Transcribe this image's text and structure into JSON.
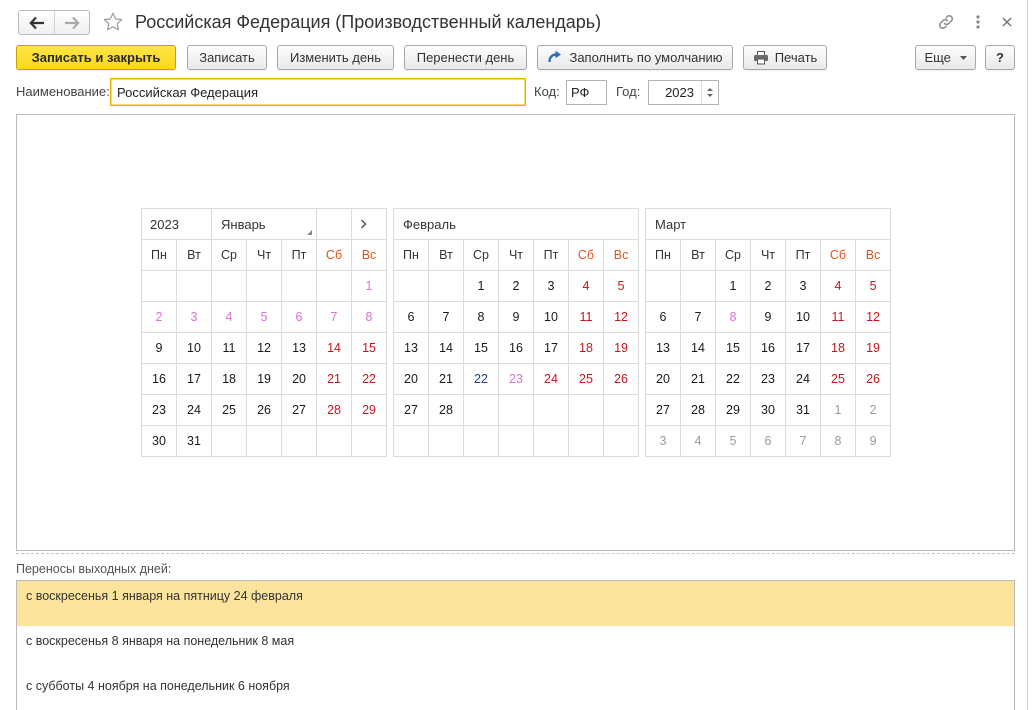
{
  "window": {
    "title": "Российская Федерация (Производственный календарь)"
  },
  "icons": {
    "back": "arrow-left-icon",
    "forward": "arrow-right-icon",
    "favorite": "star-icon",
    "link": "link-icon",
    "more": "more-vertical-icon",
    "close": "close-icon",
    "fill_default": "refresh-arrow-icon",
    "print": "printer-icon",
    "more_dropdown": "caret-down-icon",
    "year_spin": "spinner-icon",
    "month_dropdown": "dropdown-corner-icon",
    "next_month": "chevron-right-icon"
  },
  "colors": {
    "primary_button": "#f9d71c",
    "focus_border": "#e7b300",
    "selected_row": "#fce49c",
    "weekend_header": "#e0541c",
    "work_day": "#1a1a1a"
  },
  "toolbar": {
    "save_close": "Записать и закрыть",
    "save": "Записать",
    "change_day": "Изменить день",
    "move_day": "Перенести день",
    "fill_default": "Заполнить по умолчанию",
    "print": "Печать",
    "more": "Еще",
    "help": "?"
  },
  "form": {
    "name_label": "Наименование:",
    "name_value": "Российская Федерация",
    "code_label": "Код:",
    "code_value": "РФ",
    "year_label": "Год:",
    "year_value": "2023"
  },
  "calendar": {
    "year": "2023",
    "weekdays": [
      "Пн",
      "Вт",
      "Ср",
      "Чт",
      "Пт",
      "Сб",
      "Вс"
    ],
    "months": [
      {
        "name": "Январь",
        "weeks": [
          [
            null,
            null,
            null,
            null,
            null,
            null,
            {
              "d": "1",
              "color": "#dd6fd6"
            }
          ],
          [
            {
              "d": "2",
              "color": "#dd6fd6"
            },
            {
              "d": "3",
              "color": "#dd6fd6"
            },
            {
              "d": "4",
              "color": "#dd6fd6"
            },
            {
              "d": "5",
              "color": "#dd6fd6"
            },
            {
              "d": "6",
              "color": "#dd6fd6"
            },
            {
              "d": "7",
              "color": "#dd6fd6"
            },
            {
              "d": "8",
              "color": "#dd6fd6"
            }
          ],
          [
            {
              "d": "9"
            },
            {
              "d": "10"
            },
            {
              "d": "11"
            },
            {
              "d": "12"
            },
            {
              "d": "13"
            },
            {
              "d": "14",
              "color": "#c4161c"
            },
            {
              "d": "15",
              "color": "#c4161c"
            }
          ],
          [
            {
              "d": "16"
            },
            {
              "d": "17"
            },
            {
              "d": "18"
            },
            {
              "d": "19"
            },
            {
              "d": "20"
            },
            {
              "d": "21",
              "color": "#c4161c"
            },
            {
              "d": "22",
              "color": "#c4161c"
            }
          ],
          [
            {
              "d": "23"
            },
            {
              "d": "24"
            },
            {
              "d": "25"
            },
            {
              "d": "26"
            },
            {
              "d": "27"
            },
            {
              "d": "28",
              "color": "#c4161c"
            },
            {
              "d": "29",
              "color": "#c4161c"
            }
          ],
          [
            {
              "d": "30"
            },
            {
              "d": "31"
            },
            null,
            null,
            null,
            null,
            null
          ]
        ]
      },
      {
        "name": "Февраль",
        "weeks": [
          [
            null,
            null,
            {
              "d": "1"
            },
            {
              "d": "2"
            },
            {
              "d": "3"
            },
            {
              "d": "4",
              "color": "#c4161c"
            },
            {
              "d": "5",
              "color": "#c4161c"
            }
          ],
          [
            {
              "d": "6"
            },
            {
              "d": "7"
            },
            {
              "d": "8"
            },
            {
              "d": "9"
            },
            {
              "d": "10"
            },
            {
              "d": "11",
              "color": "#c4161c"
            },
            {
              "d": "12",
              "color": "#c4161c"
            }
          ],
          [
            {
              "d": "13"
            },
            {
              "d": "14"
            },
            {
              "d": "15"
            },
            {
              "d": "16"
            },
            {
              "d": "17"
            },
            {
              "d": "18",
              "color": "#c4161c"
            },
            {
              "d": "19",
              "color": "#c4161c"
            }
          ],
          [
            {
              "d": "20"
            },
            {
              "d": "21"
            },
            {
              "d": "22",
              "color": "#1f3d91"
            },
            {
              "d": "23",
              "color": "#dd6fd6"
            },
            {
              "d": "24",
              "color": "#c4161c"
            },
            {
              "d": "25",
              "color": "#c4161c"
            },
            {
              "d": "26",
              "color": "#c4161c"
            }
          ],
          [
            {
              "d": "27"
            },
            {
              "d": "28"
            },
            null,
            null,
            null,
            null,
            null
          ],
          [
            null,
            null,
            null,
            null,
            null,
            null,
            null
          ]
        ]
      },
      {
        "name": "Март",
        "weeks": [
          [
            null,
            null,
            {
              "d": "1"
            },
            {
              "d": "2"
            },
            {
              "d": "3"
            },
            {
              "d": "4",
              "color": "#c4161c"
            },
            {
              "d": "5",
              "color": "#c4161c"
            }
          ],
          [
            {
              "d": "6"
            },
            {
              "d": "7"
            },
            {
              "d": "8",
              "color": "#dd6fd6"
            },
            {
              "d": "9"
            },
            {
              "d": "10"
            },
            {
              "d": "11",
              "color": "#c4161c"
            },
            {
              "d": "12",
              "color": "#c4161c"
            }
          ],
          [
            {
              "d": "13"
            },
            {
              "d": "14"
            },
            {
              "d": "15"
            },
            {
              "d": "16"
            },
            {
              "d": "17"
            },
            {
              "d": "18",
              "color": "#c4161c"
            },
            {
              "d": "19",
              "color": "#c4161c"
            }
          ],
          [
            {
              "d": "20"
            },
            {
              "d": "21"
            },
            {
              "d": "22"
            },
            {
              "d": "23"
            },
            {
              "d": "24"
            },
            {
              "d": "25",
              "color": "#c4161c"
            },
            {
              "d": "26",
              "color": "#c4161c"
            }
          ],
          [
            {
              "d": "27"
            },
            {
              "d": "28"
            },
            {
              "d": "29"
            },
            {
              "d": "30"
            },
            {
              "d": "31"
            },
            {
              "d": "1",
              "color": "#9b9b9b"
            },
            {
              "d": "2",
              "color": "#9b9b9b"
            }
          ],
          [
            {
              "d": "3",
              "color": "#9b9b9b"
            },
            {
              "d": "4",
              "color": "#9b9b9b"
            },
            {
              "d": "5",
              "color": "#9b9b9b"
            },
            {
              "d": "6",
              "color": "#9b9b9b"
            },
            {
              "d": "7",
              "color": "#9b9b9b"
            },
            {
              "d": "8",
              "color": "#9b9b9b"
            },
            {
              "d": "9",
              "color": "#9b9b9b"
            }
          ]
        ]
      }
    ]
  },
  "transfers": {
    "label": "Переносы выходных дней:",
    "items": [
      "с воскресенья 1 января на пятницу 24 февраля",
      "с воскресенья 8 января на понедельник 8 мая",
      "с субботы 4 ноября на понедельник 6 ноября"
    ]
  }
}
